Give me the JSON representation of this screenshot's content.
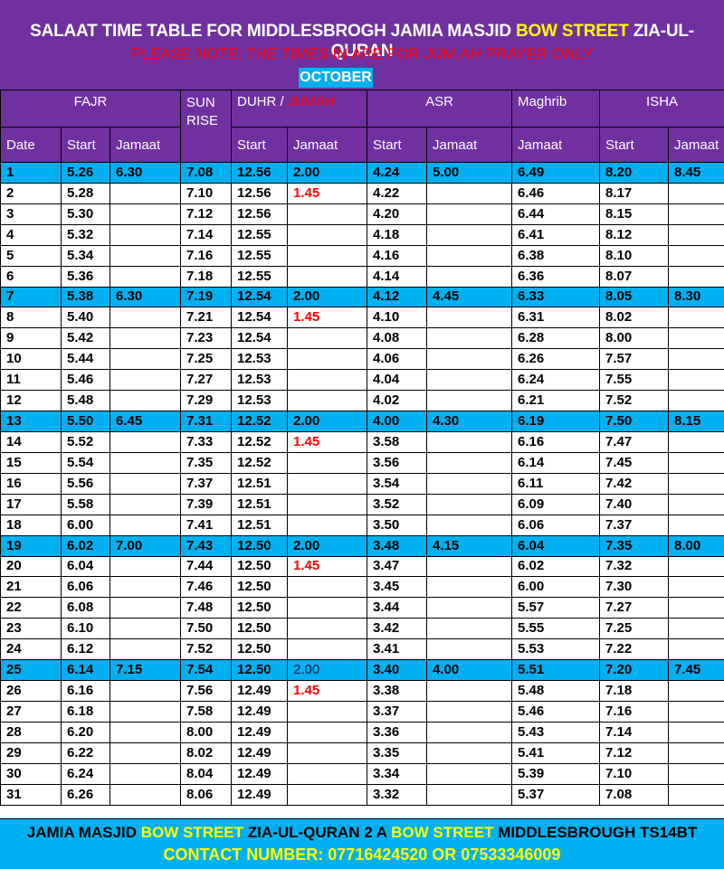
{
  "header": {
    "title_a": "SALAAT TIME TABLE FOR MIDDLESBROGH JAMIA MASJID ",
    "title_b": "BOW STREET",
    "title_c": " ZIA-UL-QURAN",
    "note": "PLEASE NOTE: THE TIMES IN ARE FOR JUM,AH PRAYER ONLY",
    "month": "OCTOBER"
  },
  "columns": {
    "fajr": "FAJR",
    "sunrise": "SUN RISE",
    "duhr": "DUHR / ",
    "jumah": "JUMAH",
    "asr": "ASR",
    "maghrib": "Maghrib",
    "isha": "ISHA",
    "sub": [
      "Date",
      "Start",
      "Jamaat",
      "Start",
      "Jamaat",
      "Start",
      "Jamaat",
      "Jamaat",
      "Start",
      "Jamaat"
    ]
  },
  "rows": [
    [
      "1",
      "5.26",
      "6.30",
      "7.08",
      "12.56",
      "2.00",
      "4.24",
      "5.00",
      "6.49",
      "8.20",
      "8.45"
    ],
    [
      "2",
      "5.28",
      "",
      "7.10",
      "12.56",
      "1.45",
      "4.22",
      "",
      "6.46",
      "8.17",
      ""
    ],
    [
      "3",
      "5.30",
      "",
      "7.12",
      "12.56",
      "",
      "4.20",
      "",
      "6.44",
      "8.15",
      ""
    ],
    [
      "4",
      "5.32",
      "",
      "7.14",
      "12.55",
      "",
      "4.18",
      "",
      "6.41",
      "8.12",
      ""
    ],
    [
      "5",
      "5.34",
      "",
      "7.16",
      "12.55",
      "",
      "4.16",
      "",
      "6.38",
      "8.10",
      ""
    ],
    [
      "6",
      "5.36",
      "",
      "7.18",
      "12.55",
      "",
      "4.14",
      "",
      "6.36",
      "8.07",
      ""
    ],
    [
      "7",
      "5.38",
      "6.30",
      "7.19",
      "12.54",
      "2.00",
      "4.12",
      "4.45",
      "6.33",
      "8.05",
      "8.30"
    ],
    [
      "8",
      "5.40",
      "",
      "7.21",
      "12.54",
      "1.45",
      "4.10",
      "",
      "6.31",
      "8.02",
      ""
    ],
    [
      "9",
      "5.42",
      "",
      "7.23",
      "12.54",
      "",
      "4.08",
      "",
      "6.28",
      "8.00",
      ""
    ],
    [
      "10",
      "5.44",
      "",
      "7.25",
      "12.53",
      "",
      "4.06",
      "",
      "6.26",
      "7.57",
      ""
    ],
    [
      "11",
      "5.46",
      "",
      "7.27",
      "12.53",
      "",
      "4.04",
      "",
      "6.24",
      "7.55",
      ""
    ],
    [
      "12",
      "5.48",
      "",
      "7.29",
      "12.53",
      "",
      "4.02",
      "",
      "6.21",
      "7.52",
      ""
    ],
    [
      "13",
      "5.50",
      "6.45",
      "7.31",
      "12.52",
      "2.00",
      "4.00",
      "4.30",
      "6.19",
      "7.50",
      "8.15"
    ],
    [
      "14",
      "5.52",
      "",
      "7.33",
      "12.52",
      "1.45",
      "3.58",
      "",
      "6.16",
      "7.47",
      ""
    ],
    [
      "15",
      "5.54",
      "",
      "7.35",
      "12.52",
      "",
      "3.56",
      "",
      "6.14",
      "7.45",
      ""
    ],
    [
      "16",
      "5.56",
      "",
      "7.37",
      "12.51",
      "",
      "3.54",
      "",
      "6.11",
      "7.42",
      ""
    ],
    [
      "17",
      "5.58",
      "",
      "7.39",
      "12.51",
      "",
      "3.52",
      "",
      "6.09",
      "7.40",
      ""
    ],
    [
      "18",
      "6.00",
      "",
      "7.41",
      "12.51",
      "",
      "3.50",
      "",
      "6.06",
      "7.37",
      ""
    ],
    [
      "19",
      "6.02",
      "7.00",
      "7.43",
      "12.50",
      "2.00",
      "3.48",
      "4.15",
      "6.04",
      "7.35",
      "8.00"
    ],
    [
      "20",
      "6.04",
      "",
      "7.44",
      "12.50",
      "1.45",
      "3.47",
      "",
      "6.02",
      "7.32",
      ""
    ],
    [
      "21",
      "6.06",
      "",
      "7.46",
      "12.50",
      "",
      "3.45",
      "",
      "6.00",
      "7.30",
      ""
    ],
    [
      "22",
      "6.08",
      "",
      "7.48",
      "12.50",
      "",
      "3.44",
      "",
      "5.57",
      "7.27",
      ""
    ],
    [
      "23",
      "6.10",
      "",
      "7.50",
      "12.50",
      "",
      "3.42",
      "",
      "5.55",
      "7.25",
      ""
    ],
    [
      "24",
      "6.12",
      "",
      "7.52",
      "12.50",
      "",
      "3.41",
      "",
      "5.53",
      "7.22",
      ""
    ],
    [
      "25",
      "6.14",
      "7.15",
      "7.54",
      "12.50",
      "2.00",
      "3.40",
      "4.00",
      "5.51",
      "7.20",
      "7.45"
    ],
    [
      "26",
      "6.16",
      "",
      "7.56",
      "12.49",
      "1.45",
      "3.38",
      "",
      "5.48",
      "7.18",
      ""
    ],
    [
      "27",
      "6.18",
      "",
      "7.58",
      "12.49",
      "",
      "3.37",
      "",
      "5.46",
      "7.16",
      ""
    ],
    [
      "28",
      "6.20",
      "",
      "8.00",
      "12.49",
      "",
      "3.36",
      "",
      "5.43",
      "7.14",
      ""
    ],
    [
      "29",
      "6.22",
      "",
      "8.02",
      "12.49",
      "",
      "3.35",
      "",
      "5.41",
      "7.12",
      ""
    ],
    [
      "30",
      "6.24",
      "",
      "8.04",
      "12.49",
      "",
      "3.34",
      "",
      "5.39",
      "7.10",
      ""
    ],
    [
      "31",
      "6.26",
      "",
      "8.06",
      "12.49",
      "",
      "3.32",
      "",
      "5.37",
      "7.08",
      ""
    ]
  ],
  "highlight_rows": [
    "1",
    "7",
    "13",
    "19",
    "25"
  ],
  "footer": {
    "line1_a": "JAMIA MASJID ",
    "line1_b": "BOW STREET",
    "line1_c": " ZIA-UL-QURAN 2 A ",
    "line1_d": "BOW STREET",
    "line1_e": " MIDDLESBROUGH TS14BT",
    "contact": "CONTACT NUMBER: 07716424520 OR 07533346009"
  },
  "colors": {
    "header_bg": "#7030a0",
    "highlight_bg": "#00b0f0",
    "accent_yellow": "#ffff00",
    "jumah_red": "#ff0000",
    "cell_blue": "#4f81f0"
  }
}
